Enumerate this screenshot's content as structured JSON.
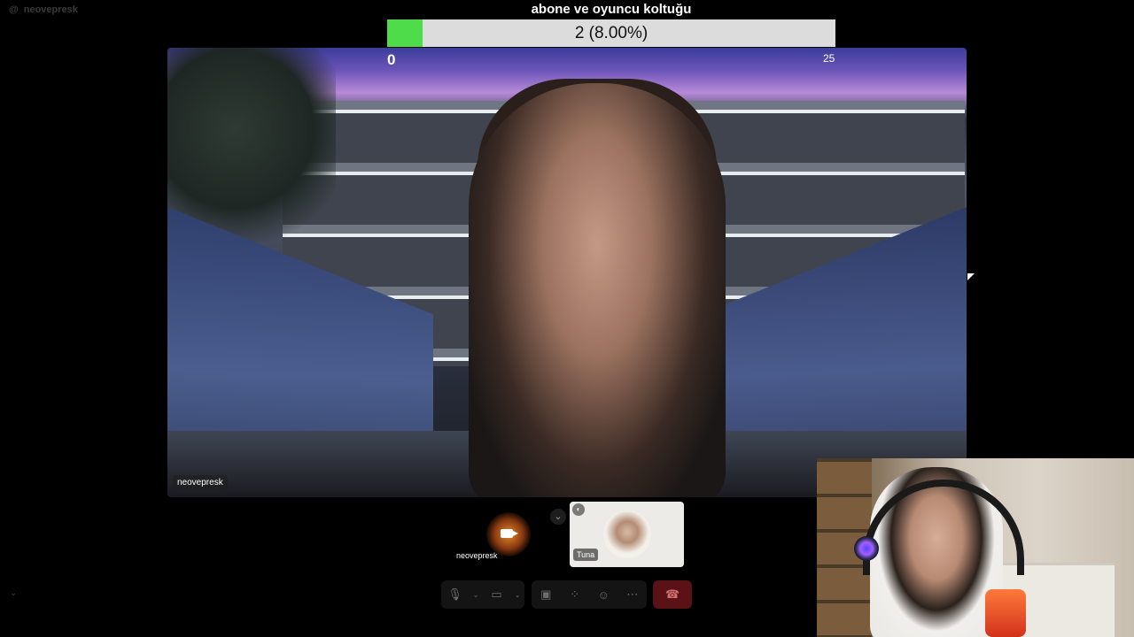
{
  "window": {
    "username": "neovepresk"
  },
  "goal": {
    "title": "abone ve oyuncu koltuğu",
    "status_text": "2 (8.00%)",
    "current": 2,
    "target": 25,
    "progress_fraction": 0.08,
    "min_label": "0",
    "max_label": "25",
    "fill_color": "#4fdc4a"
  },
  "main_video": {
    "name_label": "neovepresk"
  },
  "participants": [
    {
      "name": "neovepresk",
      "camera_off_icon": "video-camera-icon"
    },
    {
      "name": "Tuna",
      "badge_icon": "speaker-icon"
    }
  ],
  "controls": {
    "icons": [
      "microphone-icon",
      "camera-off-icon",
      "share-screen-icon",
      "grid-icon",
      "reactions-icon",
      "more-icon"
    ],
    "leave_icon": "hang-up-icon",
    "leave_color": "#5a1216"
  }
}
